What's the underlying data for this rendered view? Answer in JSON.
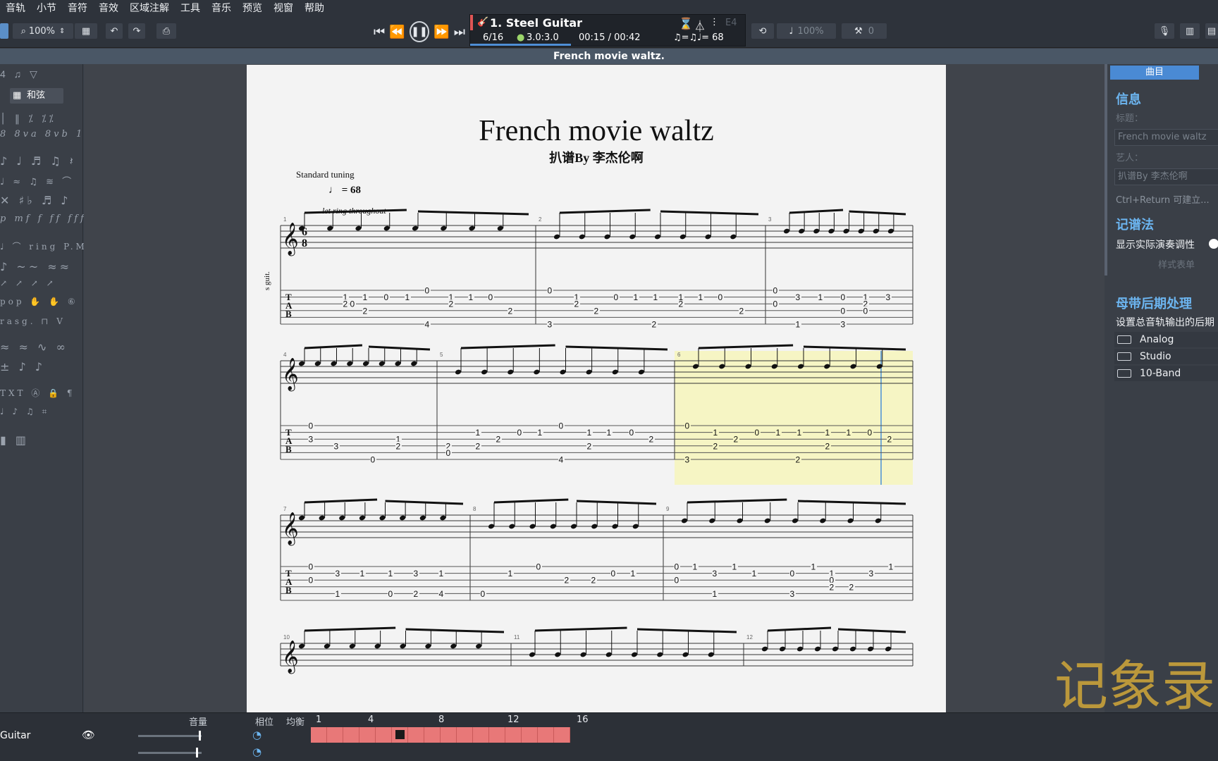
{
  "menu": [
    "音轨",
    "小节",
    "音符",
    "音效",
    "区域注解",
    "工具",
    "音乐",
    "预览",
    "视窗",
    "帮助"
  ],
  "toolbar": {
    "zoom": "100%",
    "tempo_pct": "100%",
    "transpose": "0"
  },
  "lcd": {
    "track": "1. Steel Guitar",
    "bar": "6/16",
    "beat": "3.0:3.0",
    "time": "00:15 / 00:42",
    "swing": "♫=♫",
    "tempo": "♩= 68",
    "key": "E4"
  },
  "document_title": "French movie waltz.",
  "score": {
    "title": "French movie waltz",
    "subtitle": "扒谱By 李杰伦啊",
    "tuning": "Standard tuning",
    "tempo": "= 68",
    "instruction": "let ring throughout",
    "track_label": "s guit.",
    "tab_letters": [
      "T",
      "A",
      "B"
    ],
    "measures": [
      "1",
      "2",
      "3",
      "4",
      "5",
      "6",
      "7",
      "8",
      "9",
      "10",
      "11",
      "12"
    ],
    "tab_systems": [
      [
        [
          "1",
          1,
          490
        ],
        [
          "2",
          2,
          490
        ],
        [
          "0",
          2,
          500
        ],
        [
          "2",
          3,
          518
        ],
        [
          "1",
          1,
          518
        ],
        [
          "0",
          1,
          548
        ],
        [
          "1",
          1,
          578
        ],
        [
          "0",
          0,
          606
        ],
        [
          "4",
          5,
          606
        ],
        [
          "1",
          1,
          640
        ],
        [
          "2",
          2,
          640
        ],
        [
          "1",
          1,
          668
        ],
        [
          "0",
          1,
          696
        ],
        [
          "2",
          3,
          724
        ]
      ],
      [
        [
          "0",
          0,
          780
        ],
        [
          "3",
          5,
          780
        ],
        [
          "1",
          1,
          818
        ],
        [
          "2",
          2,
          818
        ],
        [
          "2",
          3,
          846
        ],
        [
          "0",
          1,
          874
        ],
        [
          "1",
          1,
          902
        ],
        [
          "1",
          1,
          930
        ],
        [
          "2",
          2,
          966
        ],
        [
          "2",
          5,
          928
        ],
        [
          "1",
          1,
          966
        ],
        [
          "1",
          1,
          994
        ],
        [
          "0",
          1,
          1022
        ],
        [
          "2",
          3,
          1052
        ]
      ],
      [
        [
          "0",
          0,
          1100
        ],
        [
          "0",
          2,
          1100
        ],
        [
          "3",
          1,
          1132
        ],
        [
          "1",
          5,
          1132
        ],
        [
          "1",
          1,
          1164
        ],
        [
          "0",
          1,
          1196
        ],
        [
          "0",
          3,
          1196
        ],
        [
          "3",
          5,
          1196
        ],
        [
          "1",
          1,
          1228
        ],
        [
          "2",
          2,
          1228
        ],
        [
          "0",
          3,
          1228
        ],
        [
          "3",
          1,
          1260
        ]
      ]
    ]
  },
  "score_row2": {
    "tab": [
      [
        [
          "0",
          0,
          441
        ],
        [
          "3",
          2,
          441
        ],
        [
          "3",
          3,
          477
        ],
        [
          "1",
          2,
          565
        ],
        [
          "2",
          3,
          565
        ],
        [
          "0",
          5,
          529
        ],
        [
          "2",
          3,
          636
        ],
        [
          "0",
          4,
          636
        ],
        [
          "1",
          1,
          678
        ],
        [
          "2",
          3,
          678
        ],
        [
          "2",
          2,
          707
        ],
        [
          "0",
          1,
          737
        ],
        [
          "1",
          1,
          766
        ],
        [
          "0",
          0,
          796
        ],
        [
          "4",
          5,
          796
        ],
        [
          "1",
          1,
          836
        ],
        [
          "2",
          3,
          836
        ],
        [
          "1",
          1,
          864
        ],
        [
          "0",
          1,
          896
        ],
        [
          "2",
          2,
          924
        ]
      ],
      [
        [
          "0",
          0,
          975
        ],
        [
          "3",
          5,
          975
        ],
        [
          "1",
          1,
          1015
        ],
        [
          "2",
          3,
          1015
        ],
        [
          "2",
          2,
          1044
        ],
        [
          "0",
          1,
          1074
        ],
        [
          "1",
          1,
          1104
        ],
        [
          "1",
          1,
          1134
        ],
        [
          "2",
          3,
          1174
        ],
        [
          "2",
          5,
          1132
        ],
        [
          "1",
          1,
          1174
        ],
        [
          "1",
          1,
          1204
        ],
        [
          "0",
          1,
          1234
        ],
        [
          "2",
          2,
          1262
        ]
      ]
    ]
  },
  "score_row3": {
    "tab": [
      [
        [
          "0",
          0,
          441
        ],
        [
          "0",
          2,
          441
        ],
        [
          "3",
          1,
          479
        ],
        [
          "1",
          4,
          479
        ],
        [
          "1",
          1,
          514
        ],
        [
          "0",
          4,
          554
        ],
        [
          "1",
          1,
          554
        ],
        [
          "2",
          4,
          590
        ],
        [
          "3",
          1,
          590
        ],
        [
          "4",
          4,
          626
        ],
        [
          "1",
          1,
          626
        ]
      ],
      [
        [
          "0",
          0,
          764
        ],
        [
          "0",
          4,
          685
        ],
        [
          "1",
          1,
          724
        ],
        [
          "2",
          2,
          804
        ],
        [
          "2",
          2,
          842
        ],
        [
          "0",
          1,
          870
        ],
        [
          "1",
          1,
          898
        ]
      ],
      [
        [
          "0",
          0,
          960
        ],
        [
          "0",
          2,
          960
        ],
        [
          "1",
          0,
          986
        ],
        [
          "3",
          1,
          1014
        ],
        [
          "1",
          0,
          1042
        ],
        [
          "1",
          4,
          1014
        ],
        [
          "1",
          1,
          1070
        ],
        [
          "0",
          1,
          1124
        ],
        [
          "1",
          0,
          1154
        ],
        [
          "1",
          1,
          1180
        ],
        [
          "0",
          2,
          1180
        ],
        [
          "2",
          3,
          1180
        ],
        [
          "3",
          4,
          1124
        ],
        [
          "2",
          3,
          1208
        ],
        [
          "3",
          1,
          1236
        ],
        [
          "1",
          0,
          1264
        ]
      ]
    ]
  },
  "right": {
    "tab": "曲目",
    "info_heading": "信息",
    "title_label": "标题：",
    "title_value": "French movie waltz",
    "artist_label": "艺人：",
    "artist_value": "扒谱By 李杰伦啊",
    "hint": "Ctrl+Return 可建立...",
    "notation_heading": "记谱法",
    "notation_option": "显示实际演奏调性",
    "style_link": "样式表单",
    "master_heading": "母带后期处理",
    "master_desc": "设置总音轨输出的后期",
    "effects": [
      "Analog",
      "Studio",
      "10-Band"
    ]
  },
  "bottom": {
    "volume": "音量",
    "pan": "相位",
    "balance": "均衡",
    "track_name": "Guitar",
    "bar_numbers": [
      "1",
      "4",
      "8",
      "12",
      "16"
    ]
  },
  "watermark": "记象录"
}
